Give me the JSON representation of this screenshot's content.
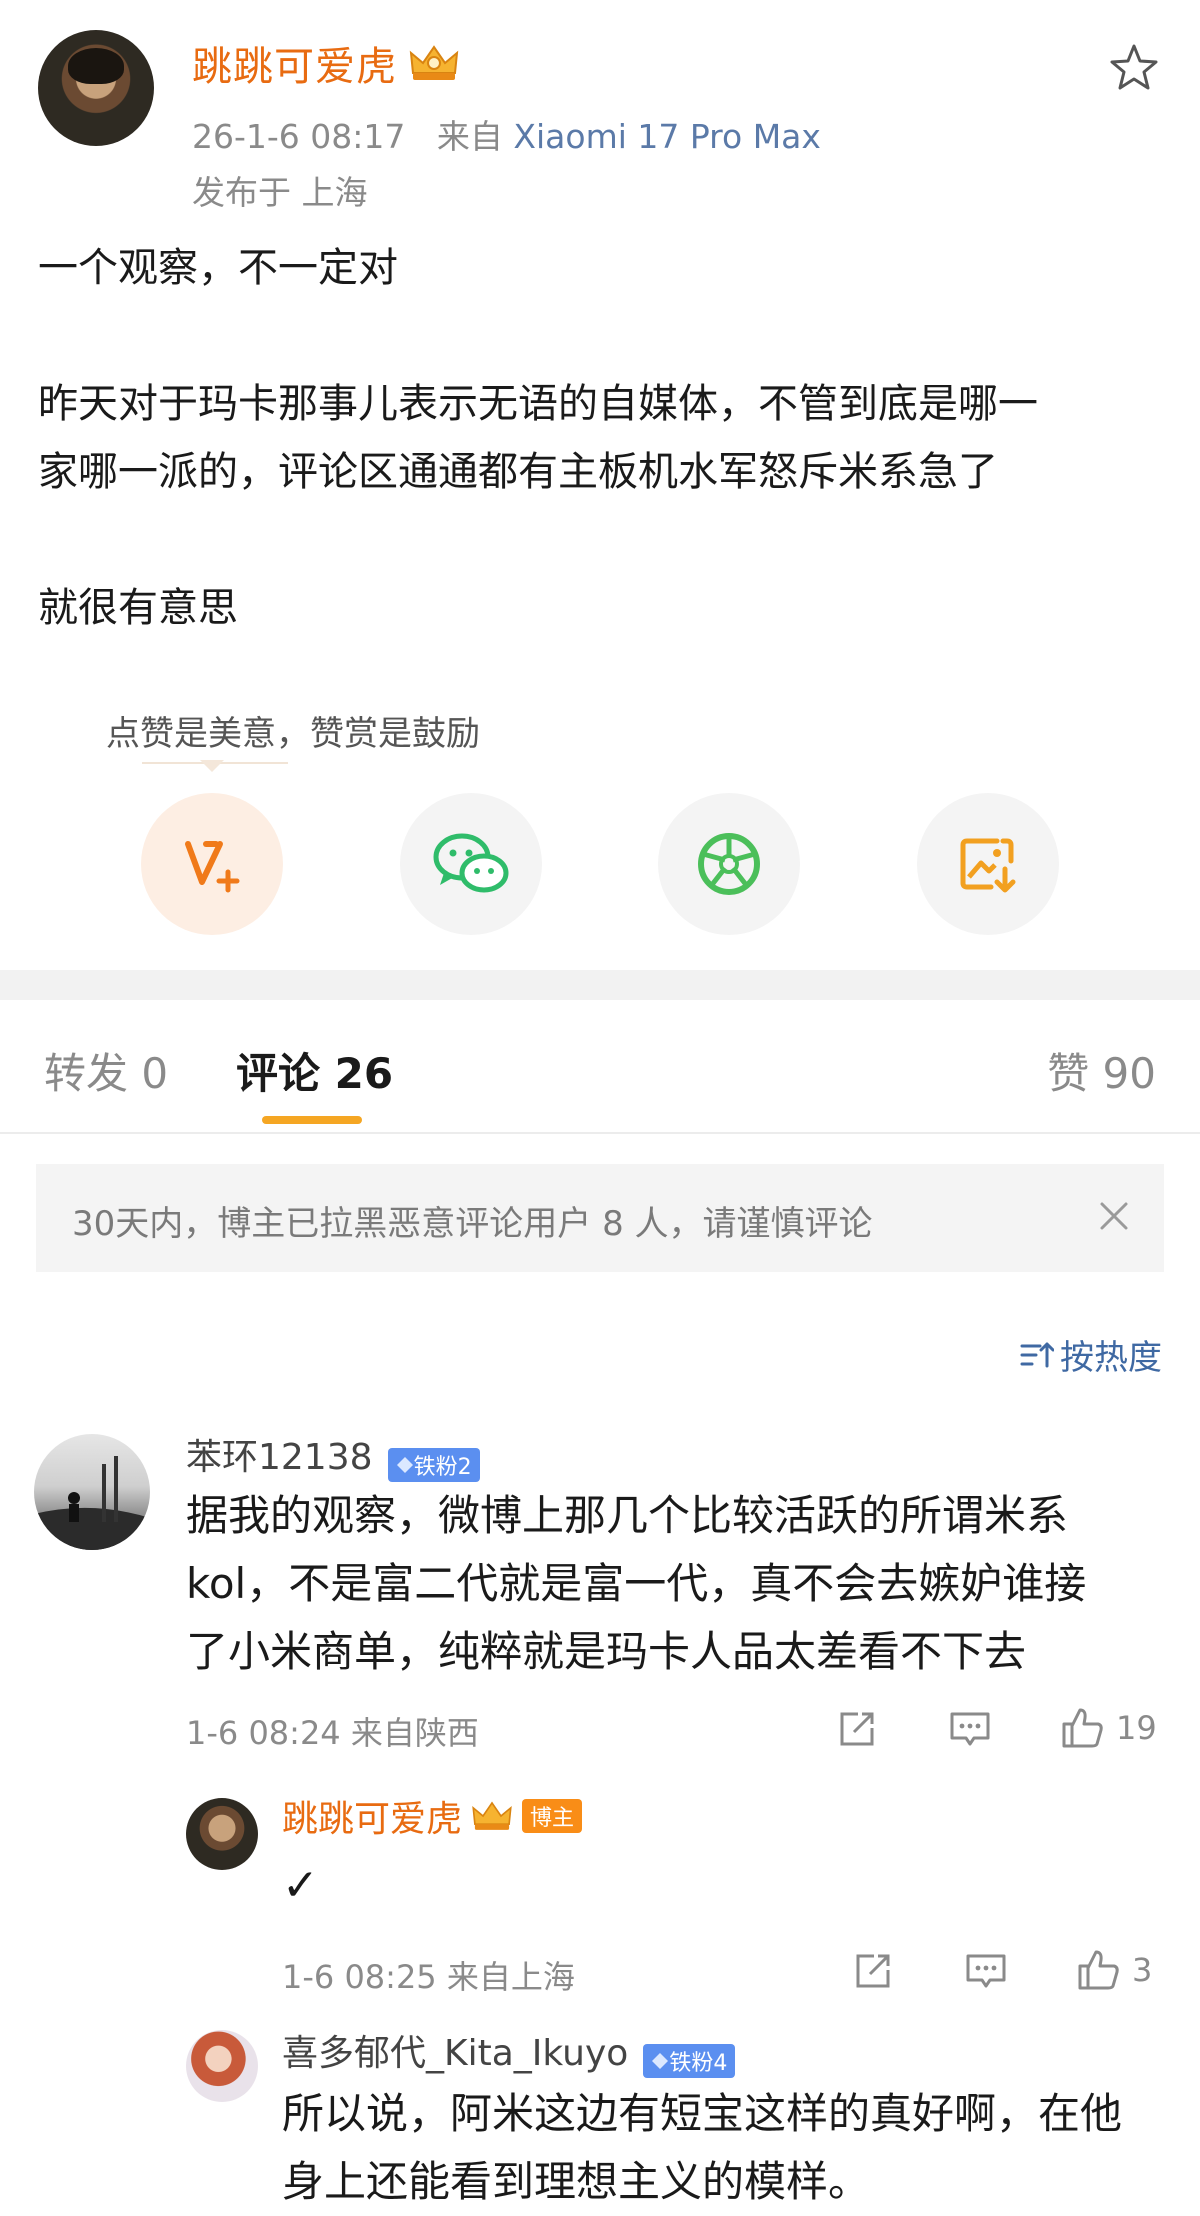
{
  "author": {
    "name": "跳跳可爱虎",
    "time": "26-1-6 08:17",
    "source_prefix": "来自",
    "device": "Xiaomi 17 Pro Max",
    "location": "发布于 上海"
  },
  "post": {
    "lines": [
      "一个观察，不一定对",
      "昨天对于玛卡那事儿表示无语的自媒体，不管到底是哪一",
      "家哪一派的，评论区通通都有主板机水军怒斥米系急了",
      "就很有意思"
    ]
  },
  "reward": {
    "tip": "点赞是美意，赞赏是鼓励"
  },
  "tabs": {
    "repost": "转发 0",
    "comments": "评论 26",
    "likes": "赞 90"
  },
  "notice": {
    "text": "30天内，博主已拉黑恶意评论用户 8 人，请谨慎评论"
  },
  "sort": {
    "label": "按热度"
  },
  "comments": [
    {
      "name": "苯环12138",
      "badge": "铁粉2",
      "lines": [
        "据我的观察，微博上那几个比较活跃的所谓米系",
        "kol，不是富二代就是富一代，真不会去嫉妒谁接",
        "了小米商单，纯粹就是玛卡人品太差看不下去"
      ],
      "time": "1-6 08:24 来自陕西",
      "likes": "19"
    }
  ],
  "replies": [
    {
      "name": "跳跳可爱虎",
      "badge": "博主",
      "text": "✓",
      "time": "1-6 08:25 来自上海",
      "likes": "3"
    },
    {
      "name": "喜多郁代_Kita_Ikuyo",
      "badge": "铁粉4",
      "lines": [
        "所以说，阿米这边有短宝这样的真好啊，在他",
        "身上还能看到理想主义的模样。"
      ]
    }
  ],
  "colors": {
    "accent": "#e86b11",
    "link": "#3f69a3",
    "tab_underline": "#f5a623",
    "fan_badge": "#5b8ff0",
    "host_badge": "#f98d17"
  }
}
